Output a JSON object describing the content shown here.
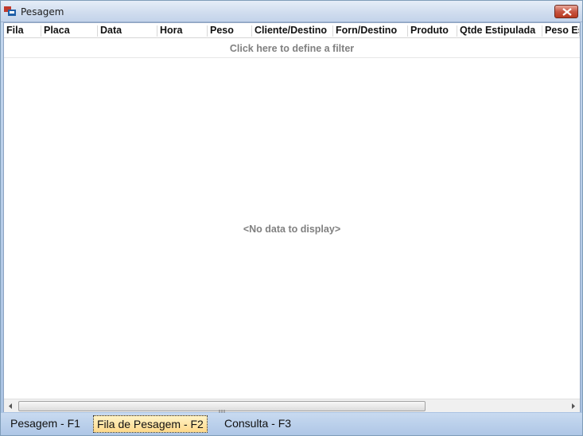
{
  "window": {
    "title": "Pesagem",
    "colors": {
      "close": "#c75643",
      "frame": "#a9c2e2",
      "active_tab": "#ffd98a"
    }
  },
  "grid": {
    "columns": [
      "Fila",
      "Placa",
      "Data",
      "Hora",
      "Peso",
      "Cliente/Destino",
      "Forn/Destino",
      "Produto",
      "Qtde Estipulada",
      "Peso Es"
    ],
    "filter_prompt": "Click here to define a filter",
    "empty_text": "<No data to display>",
    "scroll_grip": "III"
  },
  "tabs": [
    {
      "label": "Pesagem - F1",
      "active": false
    },
    {
      "label": "Fila de Pesagem - F2",
      "active": true
    },
    {
      "label": "Consulta - F3",
      "active": false
    }
  ]
}
